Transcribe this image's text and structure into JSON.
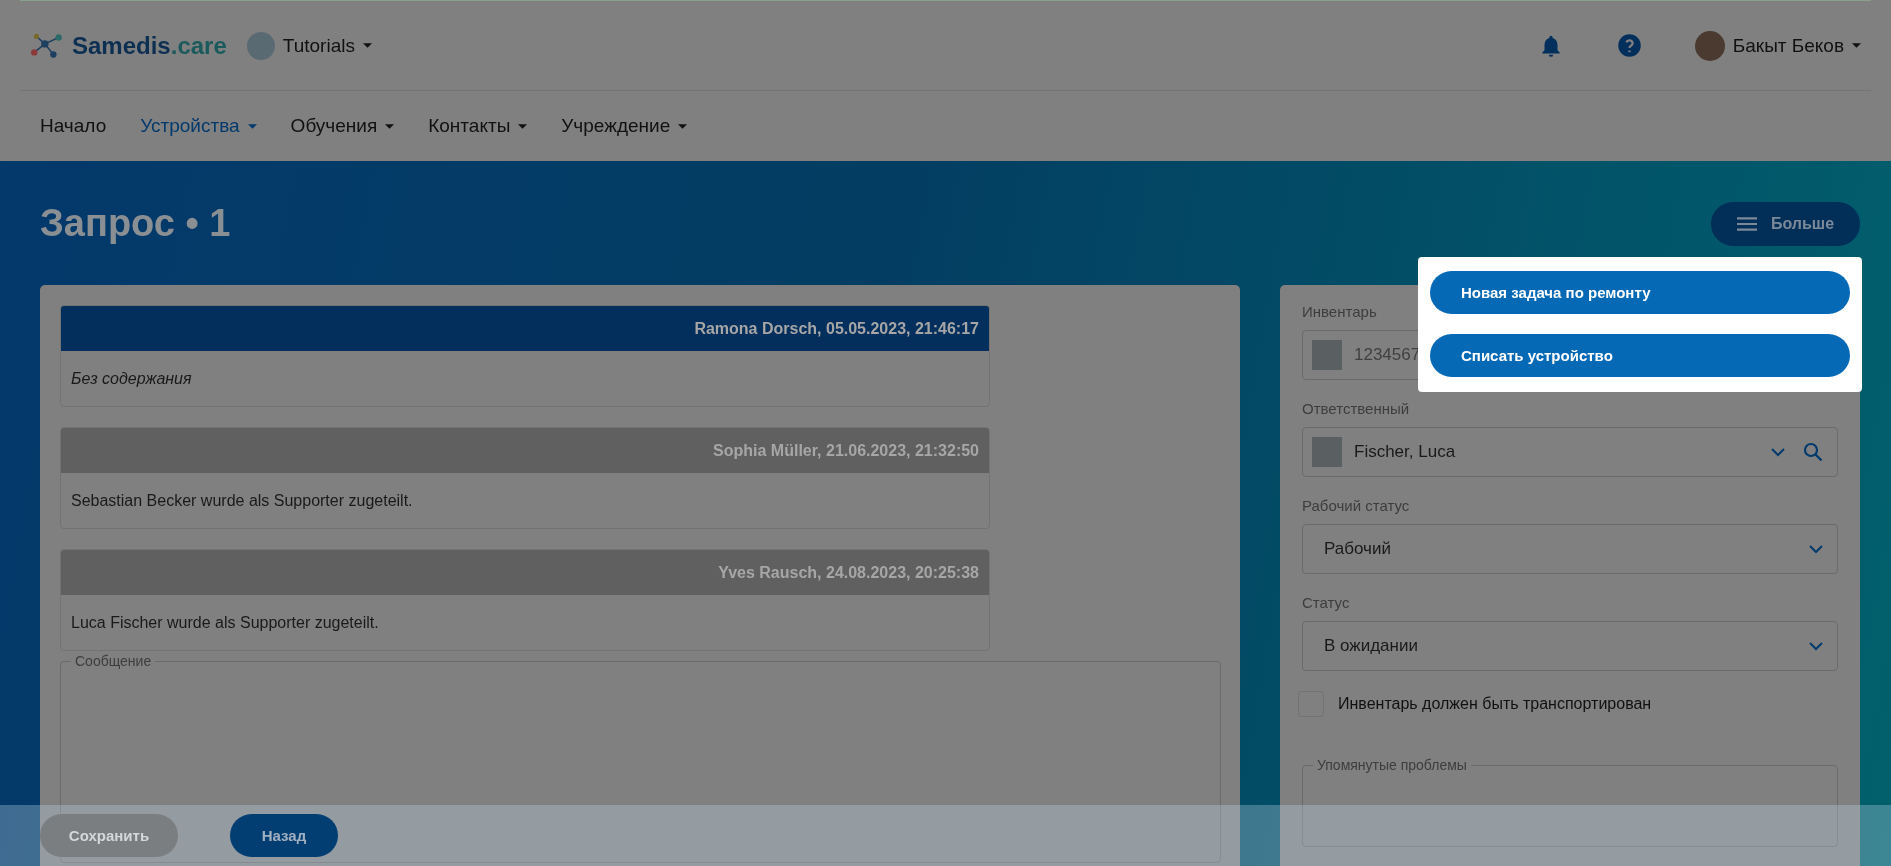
{
  "header": {
    "logo": {
      "primary": "Samedis",
      "secondary": ".care"
    },
    "tenant": "Tutorials",
    "user": "Бакыт Беков"
  },
  "nav": [
    {
      "label": "Начало",
      "selected": false,
      "has_menu": false
    },
    {
      "label": "Устройства",
      "selected": true,
      "has_menu": true
    },
    {
      "label": "Обучения",
      "selected": false,
      "has_menu": true
    },
    {
      "label": "Контакты",
      "selected": false,
      "has_menu": true
    },
    {
      "label": "Учреждение",
      "selected": false,
      "has_menu": true
    }
  ],
  "page": {
    "title": "Запрос • 1",
    "more_button": "Больше"
  },
  "messages": [
    {
      "meta": "Ramona Dorsch, 05.05.2023, 21:46:17",
      "body": "Без содержания",
      "highlighted": true,
      "empty": true
    },
    {
      "meta": "Sophia Müller, 21.06.2023, 21:32:50",
      "body": "Sebastian Becker wurde als Supporter zugeteilt.",
      "highlighted": false,
      "empty": false
    },
    {
      "meta": "Yves Rausch, 24.08.2023, 20:25:38",
      "body": "Luca Fischer wurde als Supporter zugeteilt.",
      "highlighted": false,
      "empty": false
    }
  ],
  "message_field": {
    "label": "Сообщение"
  },
  "fields": [
    {
      "kind": "inventory",
      "label": "Инвентарь",
      "value": "1234567"
    },
    {
      "kind": "person",
      "label": "Ответственный",
      "value": "Fischer, Luca"
    },
    {
      "kind": "select",
      "label": "Рабочий статус",
      "value": "Рабочий"
    },
    {
      "kind": "select",
      "label": "Статус",
      "value": "В ожидании"
    }
  ],
  "transport_checkbox": {
    "label": "Инвентарь должен быть транспортирован",
    "checked": false
  },
  "problems_field": {
    "label": "Упомянутые проблемы"
  },
  "menu": [
    "Новая задача по ремонту",
    "Списать устройство"
  ],
  "footer": [
    {
      "label": "Сохранить",
      "disabled": true
    },
    {
      "label": "Назад",
      "disabled": false
    }
  ]
}
